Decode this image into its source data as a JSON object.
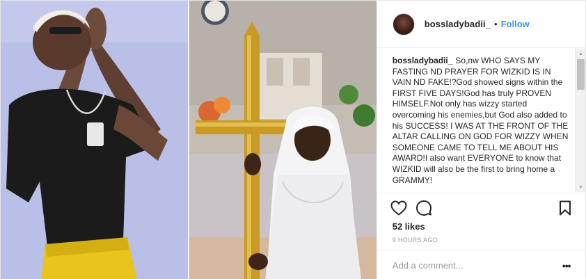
{
  "post": {
    "username": "bossladybadii_",
    "separator": "•",
    "follow_label": "Follow",
    "caption_user": "bossladybadii_",
    "caption_text": "So,nw WHO SAYS MY FASTING ND PRAYER FOR WIZKID IS IN VAIN ND FAKE!?God showed signs within the FIRST FIVE DAYS!God has truly PROVEN HIMSELF.Not only has wizzy started overcoming his enemies,but God also added to his SUCCESS! I WAS AT THE FRONT OF THE ALTAR CALLING ON GOD FOR WIZZY WHEN SOMEONE CAME TO TELL ME ABOUT HIS AWARD!I also want EVERYONE to know that WIZKID will also be the first to bring home a GRAMMY!",
    "likes": "52 likes",
    "timestamp": "9 HOURS AGO",
    "comment_placeholder": "Add a comment...",
    "more_glyph": "•••"
  },
  "icons": {
    "like": "heart-outline-icon",
    "comment": "speech-bubble-icon",
    "save": "bookmark-icon",
    "more": "more-options-icon",
    "scroll_up": "scroll-up-arrow-icon",
    "scroll_down": "scroll-down-arrow-icon"
  },
  "colors": {
    "link": "#3897f0",
    "text": "#262626",
    "muted": "#999999",
    "border": "#efefef"
  },
  "media": {
    "left_photo": "man-praying-yellow-pants",
    "right_photo": "woman-white-veil-golden-cross"
  }
}
